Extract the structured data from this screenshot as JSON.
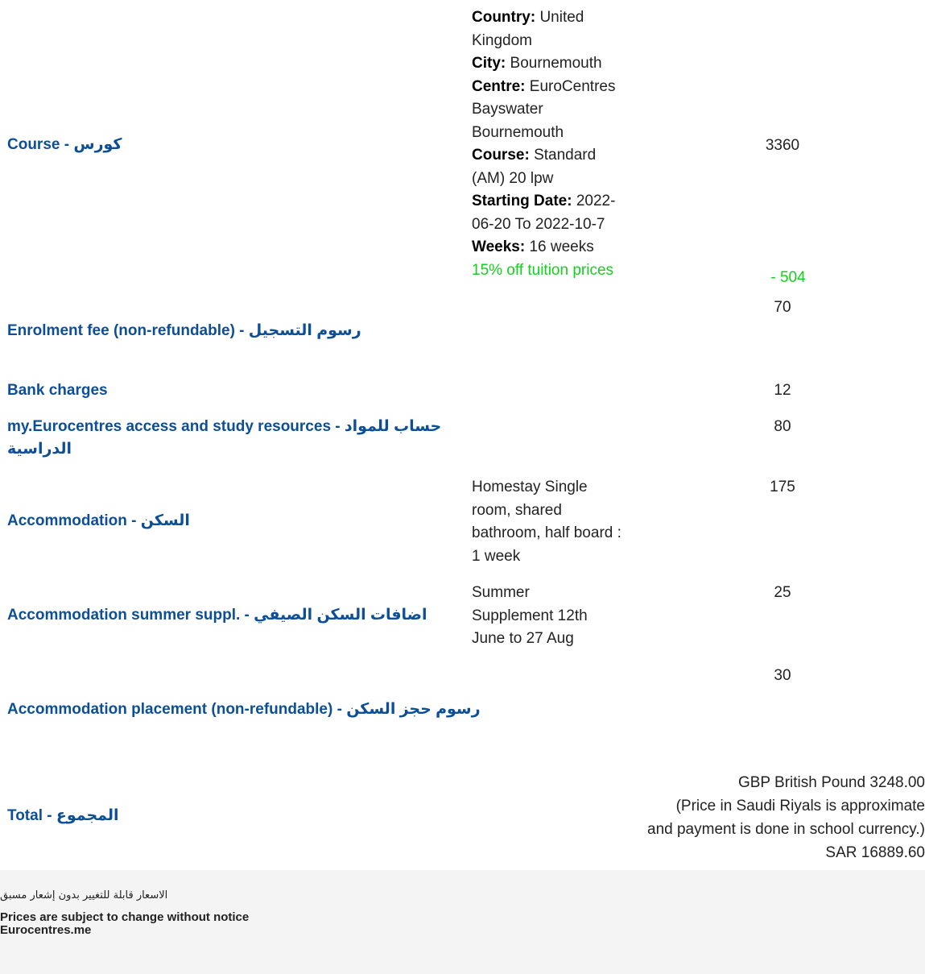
{
  "rows": {
    "course": {
      "label": "Course - كورس",
      "details": {
        "country_label": "Country:",
        "country": "United Kingdom",
        "city_label": "City:",
        "city": "Bournemouth",
        "centre_label": "Centre:",
        "centre": "EuroCentres Bayswater Bournemouth",
        "course_label": "Course:",
        "course": "Standard (AM) 20 lpw",
        "start_label": "Starting Date:",
        "start": "2022-06-20 To 2022-10-7",
        "weeks_label": "Weeks:",
        "weeks": "16 weeks",
        "discount_note": "15% off tuition prices"
      },
      "price": "3360",
      "discount": "- 504"
    },
    "enrolment": {
      "label": "Enrolment fee (non-refundable) - رسوم التسجيل",
      "price": "70"
    },
    "bank": {
      "label": "Bank charges",
      "price": "12"
    },
    "resources": {
      "label": "my.Eurocentres access and study resources - حساب للمواد الدراسية",
      "price": "80"
    },
    "accommodation": {
      "label": "Accommodation - السكن",
      "details": "Homestay Single room, shared bathroom, half board : 1 week",
      "price": "175"
    },
    "summer": {
      "label": "Accommodation summer suppl. - اضافات السكن الصيفي",
      "details": "Summer Supplement 12th June to 27 Aug",
      "price": "25"
    },
    "placement": {
      "label": "Accommodation placement (non-refundable) - رسوم حجز السكن",
      "price": "30"
    }
  },
  "total": {
    "label": "Total - المجموع",
    "gbp": "GBP British Pound 3248.00",
    "note_line1": "(Price in Saudi Riyals is approximate",
    "note_line2": "and payment is done in school currency.)",
    "sar": "SAR 16889.60"
  },
  "footer": {
    "arabic_notice": "الاسعار قابلة للتغيير بدون إشعار مسبق",
    "english_notice": "Prices are subject to change without notice",
    "site": "Eurocentres.me"
  },
  "colors": {
    "label_blue": "#0d4f96",
    "discount_green": "#12d11a",
    "footer_bg": "#f4f4f4"
  }
}
